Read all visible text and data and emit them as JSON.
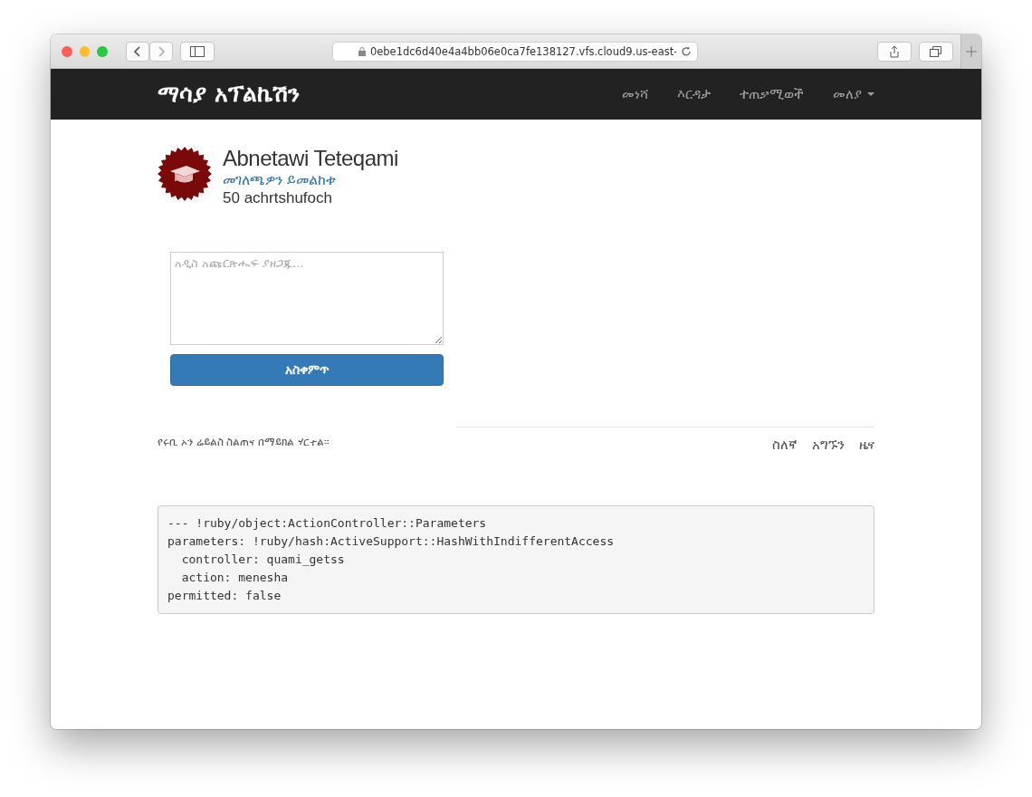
{
  "browser": {
    "url": "0ebe1dc6d40e4a4bb06e0ca7fe138127.vfs.cloud9.us-east-"
  },
  "navbar": {
    "brand": "ማሳያ አፕልኬሽን",
    "links": [
      {
        "label": "መነሻ",
        "dropdown": false
      },
      {
        "label": "እርዳታ",
        "dropdown": false
      },
      {
        "label": "ተጠቃሚወች",
        "dropdown": false
      },
      {
        "label": "መለያ",
        "dropdown": true
      }
    ]
  },
  "profile": {
    "name": "Abnetawi Teteqami",
    "link": "መገለጫዎን ይመልከቱ",
    "count": "50 achrtshufoch"
  },
  "composer": {
    "placeholder": "አዲስ አጩርጽሑፍ ያዘጋጁ...",
    "button": "አስቀምጥ"
  },
  "footer": {
    "text": "የሩቢ ኦን ሬይልስ ስልጠና በማይክል ሃርተል።",
    "links": [
      "ስለኛ",
      "አግኙን",
      "ዜና"
    ]
  },
  "debug": {
    "lines": [
      "--- !ruby/object:ActionController::Parameters",
      "parameters: !ruby/hash:ActiveSupport::HashWithIndifferentAccess",
      "  controller: quami_getss",
      "  action: menesha",
      "permitted: false"
    ]
  }
}
